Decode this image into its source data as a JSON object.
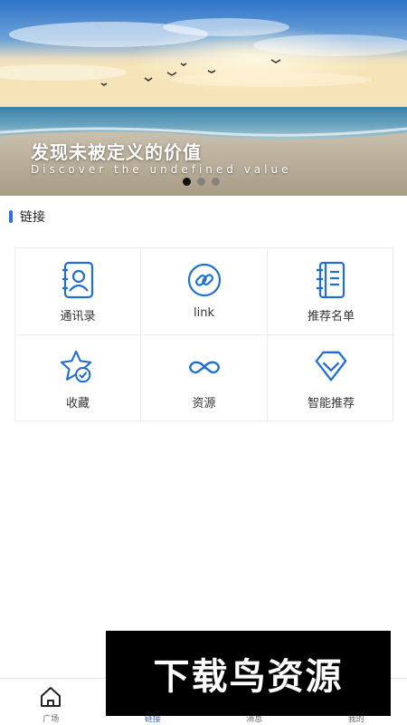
{
  "banner": {
    "title": "发现未被定义的价值",
    "subtitle": "Discover the undefined value",
    "slide_count": 3,
    "active_slide": 1
  },
  "section": {
    "title": "链接",
    "accent_color": "#2f6fe0"
  },
  "grid": {
    "items": [
      {
        "label": "通讯录",
        "icon": "contacts-book-icon"
      },
      {
        "label": "link",
        "icon": "link-icon"
      },
      {
        "label": "推荐名单",
        "icon": "notebook-icon"
      },
      {
        "label": "收藏",
        "icon": "star-check-icon"
      },
      {
        "label": "资源",
        "icon": "infinity-icon"
      },
      {
        "label": "智能推荐",
        "icon": "diamond-check-icon"
      }
    ],
    "icon_color": "#1f6fd0"
  },
  "tabbar": {
    "items": [
      {
        "label": "广场",
        "icon": "home-icon"
      },
      {
        "label": "链接",
        "icon": "link-icon",
        "active": true
      },
      {
        "label": "消息",
        "icon": "message-icon"
      },
      {
        "label": "我的",
        "icon": "user-icon"
      }
    ]
  },
  "watermark": {
    "text": "下载鸟资源"
  }
}
